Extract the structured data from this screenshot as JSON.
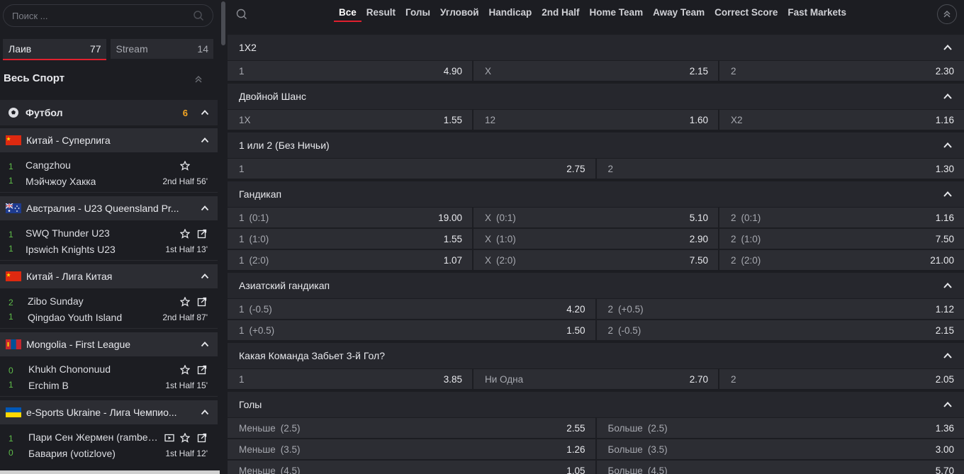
{
  "sidebar": {
    "search_placeholder": "Поиск ...",
    "tabs": [
      {
        "label": "Лаив",
        "count": "77"
      },
      {
        "label": "Stream",
        "count": "14"
      }
    ],
    "sport_title": "Весь Спорт",
    "sport": {
      "name": "Футбол",
      "count": "6"
    },
    "leagues": [
      {
        "name": "Китай - Суперлига",
        "flag": "cn",
        "match": {
          "home": "Cangzhou",
          "away": "Мэйчжоу Хакка",
          "home_score": "1",
          "away_score": "1",
          "period": "2nd Half",
          "minute": "56'"
        }
      },
      {
        "name": "Австралия - U23 Queensland Pr...",
        "flag": "au",
        "match": {
          "home": "SWQ Thunder U23",
          "away": "Ipswich Knights U23",
          "home_score": "1",
          "away_score": "1",
          "period": "1st Half",
          "minute": "13'"
        }
      },
      {
        "name": "Китай - Лига Китая",
        "flag": "cn",
        "match": {
          "home": "Zibo Sunday",
          "away": "Qingdao Youth Island",
          "home_score": "2",
          "away_score": "1",
          "period": "2nd Half",
          "minute": "87'"
        }
      },
      {
        "name": "Mongolia - First League",
        "flag": "mn",
        "match": {
          "home": "Khukh Chononuud",
          "away": "Erchim B",
          "home_score": "0",
          "away_score": "1",
          "period": "1st Half",
          "minute": "15'"
        }
      },
      {
        "name": "e-Sports Ukraine - Лига Чемпио...",
        "flag": "ua",
        "match": {
          "home": "Пари Сен Жермен (rambee...",
          "away": "Бавария (votizlove)",
          "home_score": "1",
          "away_score": "0",
          "period": "1st Half",
          "minute": "12'"
        }
      }
    ]
  },
  "filters": [
    "Все",
    "Result",
    "Голы",
    "Угловой",
    "Handicap",
    "2nd Half",
    "Home Team",
    "Away Team",
    "Correct Score",
    "Fast Markets"
  ],
  "markets": [
    {
      "title": "1X2",
      "rows": [
        [
          {
            "l": "1",
            "h": "",
            "v": "4.90"
          },
          {
            "l": "X",
            "h": "",
            "v": "2.15"
          },
          {
            "l": "2",
            "h": "",
            "v": "2.30"
          }
        ]
      ]
    },
    {
      "title": "Двойной Шанс",
      "rows": [
        [
          {
            "l": "1X",
            "h": "",
            "v": "1.55"
          },
          {
            "l": "12",
            "h": "",
            "v": "1.60"
          },
          {
            "l": "X2",
            "h": "",
            "v": "1.16"
          }
        ]
      ]
    },
    {
      "title": "1 или 2 (Без Ничьи)",
      "rows": [
        [
          {
            "l": "1",
            "h": "",
            "v": "2.75"
          },
          {
            "l": "2",
            "h": "",
            "v": "1.30"
          }
        ]
      ]
    },
    {
      "title": "Гандикап",
      "rows": [
        [
          {
            "l": "1",
            "h": "(0:1)",
            "v": "19.00"
          },
          {
            "l": "X",
            "h": "(0:1)",
            "v": "5.10"
          },
          {
            "l": "2",
            "h": "(0:1)",
            "v": "1.16"
          }
        ],
        [
          {
            "l": "1",
            "h": "(1:0)",
            "v": "1.55"
          },
          {
            "l": "X",
            "h": "(1:0)",
            "v": "2.90"
          },
          {
            "l": "2",
            "h": "(1:0)",
            "v": "7.50"
          }
        ],
        [
          {
            "l": "1",
            "h": "(2:0)",
            "v": "1.07"
          },
          {
            "l": "X",
            "h": "(2:0)",
            "v": "7.50"
          },
          {
            "l": "2",
            "h": "(2:0)",
            "v": "21.00"
          }
        ]
      ]
    },
    {
      "title": "Азиатский гандикап",
      "rows": [
        [
          {
            "l": "1",
            "h": "(-0.5)",
            "v": "4.20"
          },
          {
            "l": "2",
            "h": "(+0.5)",
            "v": "1.12"
          }
        ],
        [
          {
            "l": "1",
            "h": "(+0.5)",
            "v": "1.50"
          },
          {
            "l": "2",
            "h": "(-0.5)",
            "v": "2.15"
          }
        ]
      ]
    },
    {
      "title": "Какая Команда Забьет 3-й Гол?",
      "rows": [
        [
          {
            "l": "1",
            "h": "",
            "v": "3.85"
          },
          {
            "l": "Ни Одна",
            "h": "",
            "v": "2.70"
          },
          {
            "l": "2",
            "h": "",
            "v": "2.05"
          }
        ]
      ]
    },
    {
      "title": "Голы",
      "rows": [
        [
          {
            "l": "Меньше",
            "h": "(2.5)",
            "v": "2.55"
          },
          {
            "l": "Больше",
            "h": "(2.5)",
            "v": "1.36"
          }
        ],
        [
          {
            "l": "Меньше",
            "h": "(3.5)",
            "v": "1.26"
          },
          {
            "l": "Больше",
            "h": "(3.5)",
            "v": "3.00"
          }
        ],
        [
          {
            "l": "Меньше",
            "h": "(4.5)",
            "v": "1.05"
          },
          {
            "l": "Больше",
            "h": "(4.5)",
            "v": "5.70"
          }
        ]
      ]
    }
  ],
  "colors": {
    "accent": "#e0202e",
    "score": "#5fbf4a",
    "count": "#f5a623"
  }
}
